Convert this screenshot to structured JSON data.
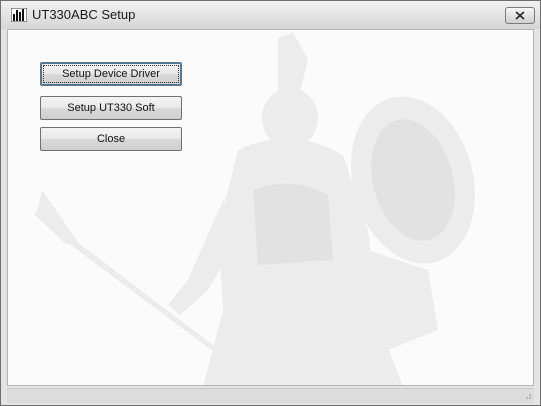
{
  "window": {
    "title": "UT330ABC Setup",
    "icon": "chart-bars-icon",
    "close_icon": "close-icon"
  },
  "buttons": {
    "setup_driver": "Setup Device Driver",
    "setup_soft": "Setup UT330 Soft",
    "close": "Close"
  },
  "background": {
    "image": "statue-athena-watermark"
  },
  "colors": {
    "titlebar": "#e2e2e2",
    "client": "#fbfbfb",
    "watermark": "#e6e6e6"
  }
}
